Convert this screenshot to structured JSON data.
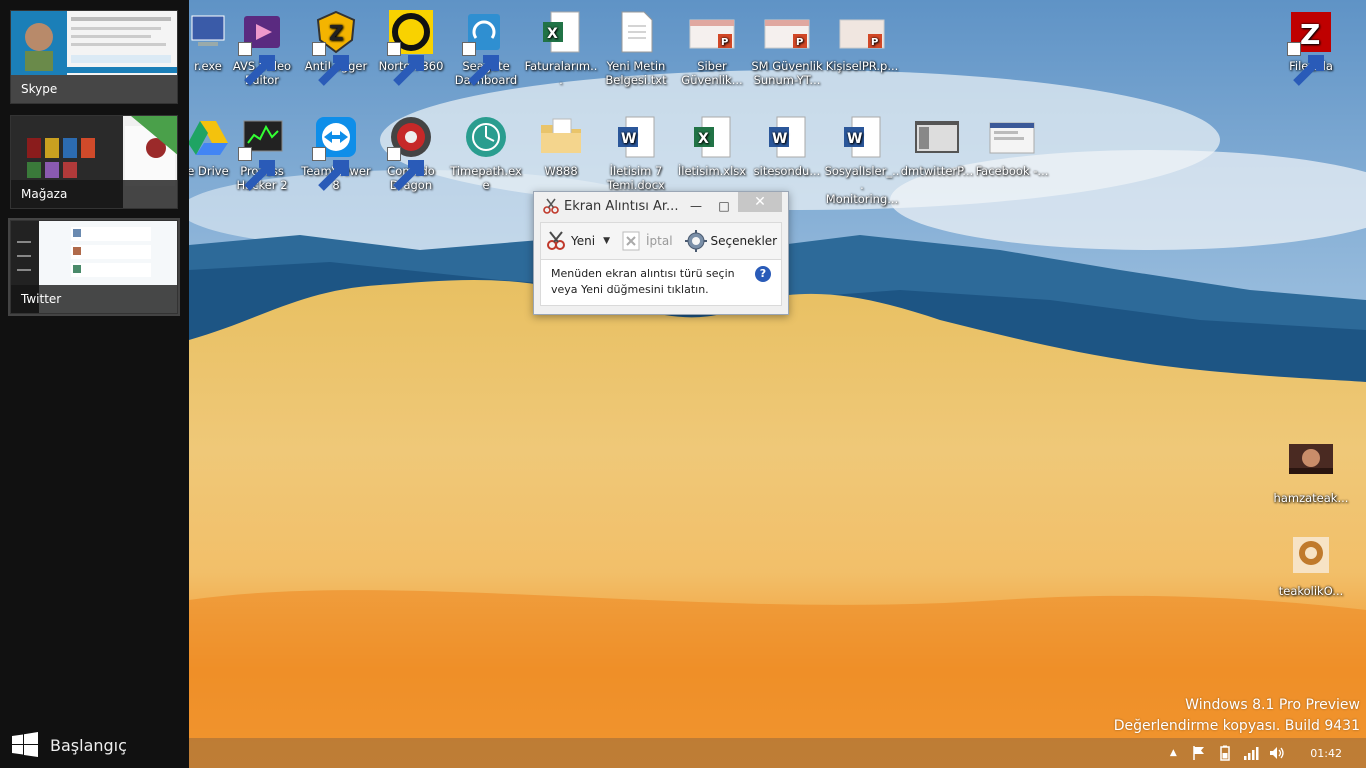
{
  "switcher": {
    "apps": [
      {
        "label": "Skype"
      },
      {
        "label": "Mağaza"
      },
      {
        "label": "Twitter"
      }
    ],
    "start_label": "Başlangıç"
  },
  "desktop": {
    "icons_row1": [
      {
        "label": "r.exe",
        "icon": "exe-icon"
      },
      {
        "label": "AVS Video Editor",
        "icon": "film-icon"
      },
      {
        "label": "AntiLogger",
        "icon": "antilogger-icon"
      },
      {
        "label": "Norton 360",
        "icon": "norton-icon"
      },
      {
        "label": "Seagate Dashboard",
        "icon": "seagate-icon"
      },
      {
        "label": "Faturalarım...",
        "icon": "excel-icon"
      },
      {
        "label": "Yeni Metin Belgesi.txt",
        "icon": "text-file-icon"
      },
      {
        "label": "Siber Güvenlik...",
        "icon": "powerpoint-icon"
      },
      {
        "label": "SM Güvenlik Sunum-YT...",
        "icon": "powerpoint-icon"
      },
      {
        "label": "KişiselPR.p...",
        "icon": "powerpoint-icon"
      }
    ],
    "icons_row2": [
      {
        "label": "e Drive",
        "icon": "drive-icon"
      },
      {
        "label": "Process Hacker 2",
        "icon": "process-hacker-icon"
      },
      {
        "label": "TeamViewer 8",
        "icon": "teamviewer-icon"
      },
      {
        "label": "Comodo Dragon",
        "icon": "comodo-icon"
      },
      {
        "label": "Timepath.exe",
        "icon": "timepath-icon"
      },
      {
        "label": "W888",
        "icon": "folder-icon"
      },
      {
        "label": "İletisim 7 Temi.docx",
        "icon": "word-icon"
      },
      {
        "label": "İletisim.xlsx",
        "icon": "excel-icon"
      },
      {
        "label": "sitesondu...",
        "icon": "word-icon"
      },
      {
        "label": "SosyalIsler_... Monitoring...",
        "icon": "word-icon"
      },
      {
        "label": "dmtwitterP...",
        "icon": "screenshot-icon"
      },
      {
        "label": "Facebook -...",
        "icon": "screenshot-icon"
      }
    ],
    "icons_right": [
      {
        "label": "FileZilla",
        "icon": "filezilla-icon"
      },
      {
        "label": "hamzateak...",
        "icon": "photo-icon"
      },
      {
        "label": "teakolikO...",
        "icon": "logo-icon"
      }
    ]
  },
  "snipping_tool": {
    "title": "Ekran Alıntısı Ar...",
    "new_label": "Yeni",
    "cancel_label": "İptal",
    "options_label": "Seçenekler",
    "message_line1": "Menüden ekran alıntısı türü seçin",
    "message_line2": "veya Yeni düğmesini tıklatın.",
    "help": "?"
  },
  "watermark": {
    "line1": "Windows 8.1 Pro Preview",
    "line2": "Değerlendirme kopyası. Build 9431"
  },
  "taskbar": {
    "clock": "01:42"
  },
  "colors": {
    "word_blue": "#2b579a",
    "excel_green": "#217346",
    "ppt_red": "#d24726",
    "filezilla_red": "#bf0000"
  }
}
